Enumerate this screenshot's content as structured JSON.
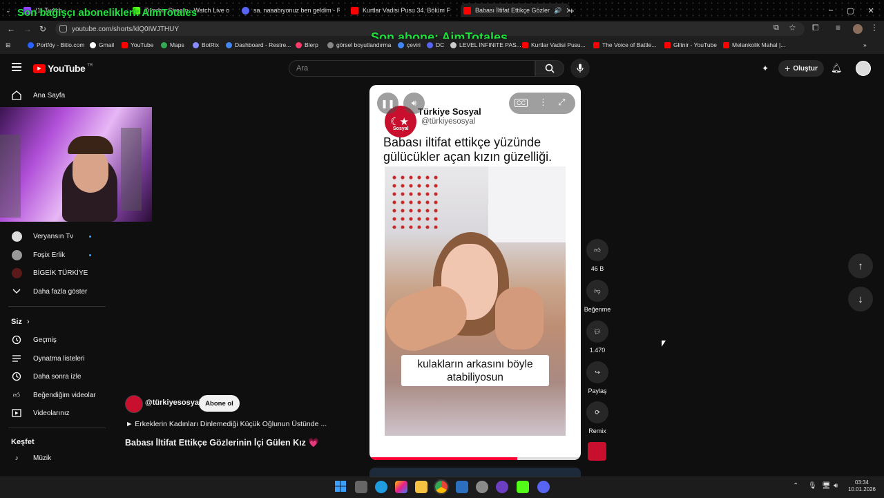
{
  "overlay": {
    "donor_text": "Son bağışçı abonelikleri: AimTotales",
    "subscriber_text": "Son abone: AimTotales"
  },
  "browser": {
    "tabs": [
      {
        "label": "(1) Twitch",
        "color": "#9146ff"
      },
      {
        "label": "Ziverbin Stream - Watch Live o",
        "color": "#53fc18"
      },
      {
        "label": "sa. naaabıyonuz ben geldim - R",
        "color": "#5865f2"
      },
      {
        "label": "Kurtlar Vadisi Pusu 34. Bölüm F",
        "color": "#ff0000"
      },
      {
        "label": "Babası İltifat Ettikçe Gözler",
        "color": "#ff0000"
      }
    ],
    "url": "youtube.com/shorts/klQ0IWJTHUY",
    "bookmarks": [
      "Portföy - Bitlo.com",
      "Gmail",
      "YouTube",
      "Maps",
      "BotRix",
      "Dashboard - Restre...",
      "Blerp",
      "görsel boyutlandırma",
      "çeviri",
      "DC",
      "LEVEL INFINITE PAS...",
      "Kurtlar Vadisi Pusu...",
      "The Voice of Battle...",
      "Glitnir - YouTube",
      "Melankolik Mahal |..."
    ]
  },
  "youtube": {
    "logo": "YouTube",
    "logo_region": "TR",
    "search_placeholder": "Ara",
    "create_label": "Oluştur",
    "sidebar": {
      "home": "Ana Sayfa",
      "subs": [
        "Veryansın Tv",
        "Foşix Erlik",
        "BİGEİK TÜRKİYE"
      ],
      "show_more": "Daha fazla göster",
      "you_heading": "Siz",
      "you_items": [
        "Geçmiş",
        "Oynatma listeleri",
        "Daha sonra izle",
        "Beğendiğim videolar",
        "Videolarınız"
      ],
      "explore_heading": "Keşfet",
      "explore_items": [
        "Müzik"
      ]
    },
    "short": {
      "channel_name": "Türkiye Sosyal",
      "channel_handle": "@türkiyesosyal",
      "avatar_text": "Sosyal",
      "headline": "Babası iltifat ettikçe yüzünde gülücükler açan kızın güzelliği.",
      "caption": "kulakların arkasını böyle atabiliyosun",
      "channel_label": "@türkiyesosyal",
      "subscribe_label": "Abone ol",
      "link_text": "► Erkeklerin Kadınları Dinlemediği Küçük Oğlunun Üstünde ...",
      "title": "Babası İltifat Ettikçe Gözlerinin İçi Gülen Kız 💗",
      "progress": 0.7
    },
    "actions": {
      "likes": "46 B",
      "dislike": "Beğenme",
      "comments": "1.470",
      "share": "Paylaş",
      "remix": "Remix"
    }
  },
  "taskbar": {
    "time": "03:34",
    "date": "10.01.2026"
  }
}
